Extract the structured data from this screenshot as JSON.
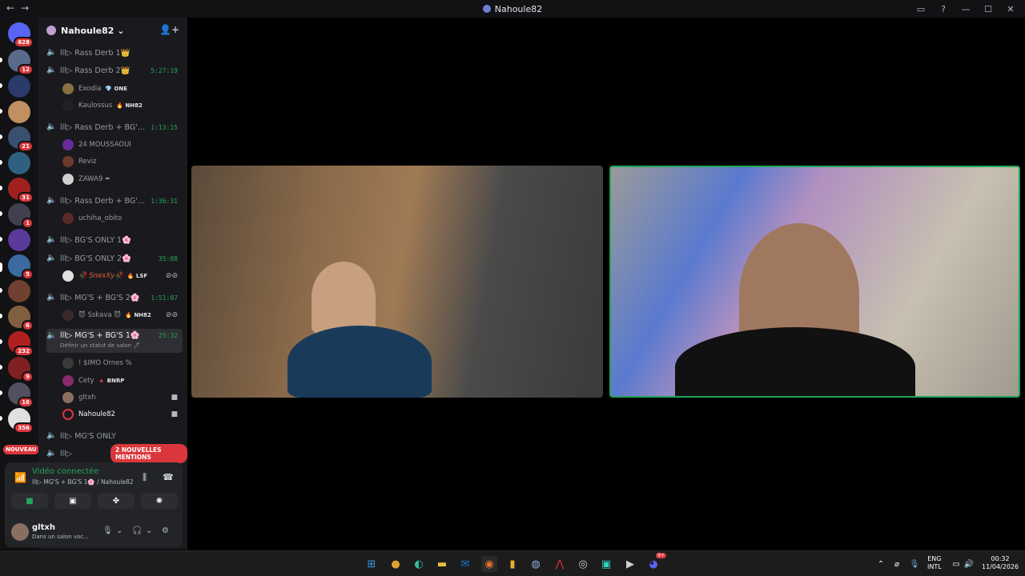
{
  "window": {
    "title": "Nahoule82"
  },
  "guild_badges": [
    "628",
    "12",
    "21",
    "31",
    "1",
    "5",
    "6",
    "232",
    "9",
    "16",
    "356"
  ],
  "nouveau_label": "NOUVEAU",
  "server": {
    "name": "Nahoule82"
  },
  "channels": [
    {
      "name": "lll▷ Rass Derb 1👑",
      "time": ""
    },
    {
      "name": "lll▷ Rass Derb 2👑",
      "time": "5:27:19"
    },
    {
      "name": "lll▷ Rass Derb + BG'...",
      "time": "1:13:15"
    },
    {
      "name": "lll▷ Rass Derb + BG'...",
      "time": "1:36:31"
    },
    {
      "name": "lll▷ BG'S ONLY 1🌸",
      "time": ""
    },
    {
      "name": "lll▷ BG'S ONLY 2🌸",
      "time": "35:08"
    },
    {
      "name": "lll▷ MG'S + BG'S 2🌸",
      "time": "1:51:07"
    },
    {
      "name": "lll▷ MG'S + BG'S 1🌸",
      "time": "25:32",
      "sub": "Définir un statut de salon 🖊"
    },
    {
      "name": "lll▷ MG'S ONLY",
      "time": ""
    },
    {
      "name": "lll▷",
      "time": ""
    }
  ],
  "members": [
    {
      "name": "Exodia",
      "tag": "💎 ONE"
    },
    {
      "name": "Kaulossus",
      "tag": "🔥 NH82"
    },
    {
      "name": "24 MOUSSAOUI",
      "tag": ""
    },
    {
      "name": "Reviz",
      "tag": ""
    },
    {
      "name": "ZAWA9 ✒",
      "tag": ""
    },
    {
      "name": "uchiha_obito",
      "tag": ""
    },
    {
      "name": "🥀 SnexXy🥀",
      "tag": "🔥 LSF"
    },
    {
      "name": "😈 Sskava 😈",
      "tag": "🔥 NH82"
    },
    {
      "name": "! $IMO Ornes %",
      "tag": ""
    },
    {
      "name": "Cety",
      "tag": "🔺 BNRP"
    },
    {
      "name": "gltxh",
      "tag": ""
    },
    {
      "name": "Nahoule82",
      "tag": ""
    }
  ],
  "mentions_label": "2 NOUVELLES MENTIONS",
  "voice": {
    "status": "Vidéo connectée",
    "location": "lll▷ MG'S + BG'S 1🌸 / Nahoule82"
  },
  "user": {
    "name": "gltxh",
    "status": "Dans un salon voc..."
  },
  "taskbar": {
    "lang": "ENG",
    "layout": "INTL",
    "time": "00:32",
    "date": "11/04/2026",
    "discord_badge": "9+"
  },
  "colors": {
    "accent_green": "#23a55a",
    "badge_red": "#da373c",
    "background": "#1a1a1e"
  }
}
